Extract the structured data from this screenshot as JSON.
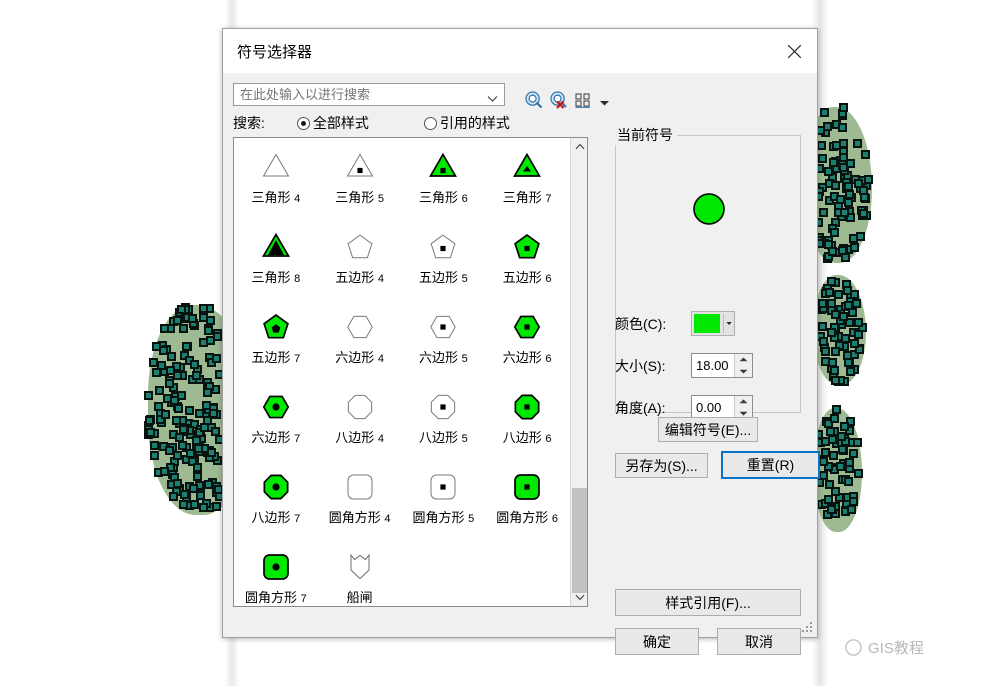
{
  "window": {
    "title": "符号选择器",
    "close_icon": "close-icon"
  },
  "search": {
    "placeholder": "在此处输入以进行搜索",
    "value": "",
    "dropdown_icon": "chevron-down-icon",
    "tools": [
      {
        "name": "search-icon",
        "label": "搜索"
      },
      {
        "name": "clear-search-icon",
        "label": "清除搜索"
      },
      {
        "name": "view-mode-icon",
        "label": "视图"
      },
      {
        "name": "view-mode-dropdown-icon",
        "label": "视图下拉"
      }
    ],
    "scope_label": "搜索:",
    "scope_options": [
      {
        "label": "全部样式",
        "selected": true
      },
      {
        "label": "引用的样式",
        "selected": false
      }
    ]
  },
  "symbol_grid": {
    "symbols": [
      {
        "label": "三角形",
        "num": "4",
        "shape": "triangle",
        "fill": "none",
        "dot": "none"
      },
      {
        "label": "三角形",
        "num": "5",
        "shape": "triangle",
        "fill": "none",
        "dot": "square"
      },
      {
        "label": "三角形",
        "num": "6",
        "shape": "triangle",
        "fill": "#00e800",
        "dot": "square"
      },
      {
        "label": "三角形",
        "num": "7",
        "shape": "triangle",
        "fill": "#00e800",
        "dot": "triangle"
      },
      {
        "label": "三角形",
        "num": "8",
        "shape": "triangle",
        "fill": "#00e800",
        "dot": "bigtriangle"
      },
      {
        "label": "五边形",
        "num": "4",
        "shape": "pentagon",
        "fill": "none",
        "dot": "none"
      },
      {
        "label": "五边形",
        "num": "5",
        "shape": "pentagon",
        "fill": "none",
        "dot": "square"
      },
      {
        "label": "五边形",
        "num": "6",
        "shape": "pentagon",
        "fill": "#00e800",
        "dot": "square"
      },
      {
        "label": "五边形",
        "num": "7",
        "shape": "pentagon",
        "fill": "#00e800",
        "dot": "pentagon"
      },
      {
        "label": "六边形",
        "num": "4",
        "shape": "hexagon",
        "fill": "none",
        "dot": "none"
      },
      {
        "label": "六边形",
        "num": "5",
        "shape": "hexagon",
        "fill": "none",
        "dot": "square"
      },
      {
        "label": "六边形",
        "num": "6",
        "shape": "hexagon",
        "fill": "#00e800",
        "dot": "square"
      },
      {
        "label": "六边形",
        "num": "7",
        "shape": "hexagon",
        "fill": "#00e800",
        "dot": "circle"
      },
      {
        "label": "八边形",
        "num": "4",
        "shape": "octagon",
        "fill": "none",
        "dot": "none"
      },
      {
        "label": "八边形",
        "num": "5",
        "shape": "octagon",
        "fill": "none",
        "dot": "square"
      },
      {
        "label": "八边形",
        "num": "6",
        "shape": "octagon",
        "fill": "#00e800",
        "dot": "square"
      },
      {
        "label": "八边形",
        "num": "7",
        "shape": "octagon",
        "fill": "#00e800",
        "dot": "circle"
      },
      {
        "label": "圆角方形",
        "num": "4",
        "shape": "roundsquare",
        "fill": "none",
        "dot": "none"
      },
      {
        "label": "圆角方形",
        "num": "5",
        "shape": "roundsquare",
        "fill": "none",
        "dot": "square"
      },
      {
        "label": "圆角方形",
        "num": "6",
        "shape": "roundsquare",
        "fill": "#00e800",
        "dot": "square"
      },
      {
        "label": "圆角方形",
        "num": "7",
        "shape": "roundsquare",
        "fill": "#00e800",
        "dot": "circle"
      },
      {
        "label": "船闸",
        "num": "",
        "shape": "lock",
        "fill": "none",
        "dot": "none"
      }
    ],
    "scroll_up_icon": "chevron-up-icon",
    "scroll_down_icon": "chevron-down-icon"
  },
  "current_symbol": {
    "group_label": "当前符号",
    "preview_shape": "circle",
    "preview_color": "#00e800",
    "fields": [
      {
        "label": "颜色(C):",
        "type": "color",
        "value": "#00e800"
      },
      {
        "label": "大小(S):",
        "type": "spin",
        "value": "18.00"
      },
      {
        "label": "角度(A):",
        "type": "spin",
        "value": "0.00"
      }
    ]
  },
  "actions": {
    "edit_symbol": "编辑符号(E)...",
    "save_as": "另存为(S)...",
    "reset": "重置(R)",
    "style_reference": "样式引用(F)...",
    "ok": "确定",
    "cancel": "取消"
  },
  "watermark": {
    "text": "GIS教程",
    "logo_icon": "circle-logo-icon"
  },
  "colors": {
    "symbol_green": "#00e800",
    "map_point": "#1c8071",
    "map_polygon": "#9dba92",
    "focus_blue": "#0a73c8",
    "dialog_bg": "#f0f0f0"
  }
}
